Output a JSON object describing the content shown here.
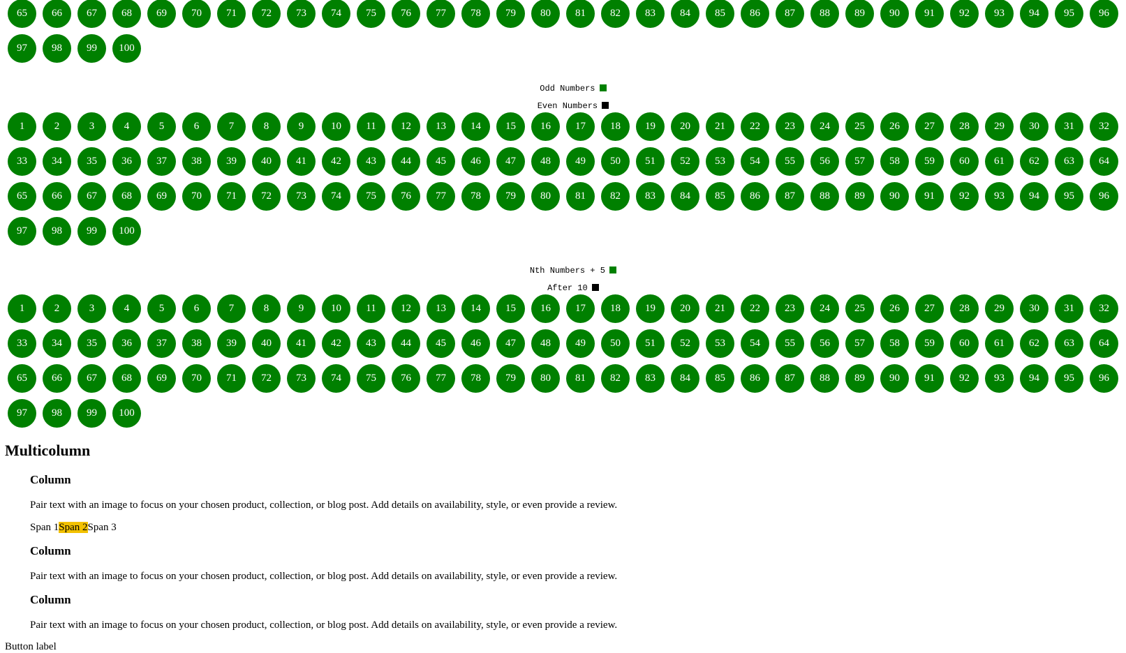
{
  "grids": {
    "top_partial": [
      [
        "65",
        "66",
        "67",
        "68",
        "69",
        "70",
        "71",
        "72",
        "73",
        "74",
        "75",
        "76",
        "77",
        "78",
        "79",
        "80",
        "81",
        "82",
        "83",
        "84",
        "85",
        "86",
        "87",
        "88",
        "89",
        "90",
        "91",
        "92",
        "93",
        "94",
        "95",
        "96"
      ],
      [
        "97",
        "98",
        "99",
        "100"
      ]
    ],
    "full": [
      [
        "1",
        "2",
        "3",
        "4",
        "5",
        "6",
        "7",
        "8",
        "9",
        "10",
        "11",
        "12",
        "13",
        "14",
        "15",
        "16",
        "17",
        "18",
        "19",
        "20",
        "21",
        "22",
        "23",
        "24",
        "25",
        "26",
        "27",
        "28",
        "29",
        "30",
        "31",
        "32"
      ],
      [
        "33",
        "34",
        "35",
        "36",
        "37",
        "38",
        "39",
        "40",
        "41",
        "42",
        "43",
        "44",
        "45",
        "46",
        "47",
        "48",
        "49",
        "50",
        "51",
        "52",
        "53",
        "54",
        "55",
        "56",
        "57",
        "58",
        "59",
        "60",
        "61",
        "62",
        "63",
        "64"
      ],
      [
        "65",
        "66",
        "67",
        "68",
        "69",
        "70",
        "71",
        "72",
        "73",
        "74",
        "75",
        "76",
        "77",
        "78",
        "79",
        "80",
        "81",
        "82",
        "83",
        "84",
        "85",
        "86",
        "87",
        "88",
        "89",
        "90",
        "91",
        "92",
        "93",
        "94",
        "95",
        "96"
      ],
      [
        "97",
        "98",
        "99",
        "100"
      ]
    ]
  },
  "legend_1": {
    "odd_label": "Odd Numbers",
    "odd_color": "#008000",
    "even_label": "Even Numbers",
    "even_color": "#000000"
  },
  "legend_2": {
    "nth_label": "Nth Numbers + 5",
    "nth_color": "#008000",
    "after_label": "After 10",
    "after_color": "#000000"
  },
  "multicolumn": {
    "title": "Multicolumn",
    "columns": [
      {
        "heading": "Column",
        "text": "Pair text with an image to focus on your chosen product, collection, or blog post. Add details on availability, style, or even provide a review."
      },
      {
        "heading": "Column",
        "text": "Pair text with an image to focus on your chosen product, collection, or blog post. Add details on availability, style, or even provide a review."
      },
      {
        "heading": "Column",
        "text": "Pair text with an image to focus on your chosen product, collection, or blog post. Add details on availability, style, or even provide a review."
      }
    ],
    "spans": [
      "Span 1",
      "Span 2",
      "Span 3"
    ],
    "highlight_color": "#f2c100"
  },
  "button": {
    "label": "Button label"
  }
}
